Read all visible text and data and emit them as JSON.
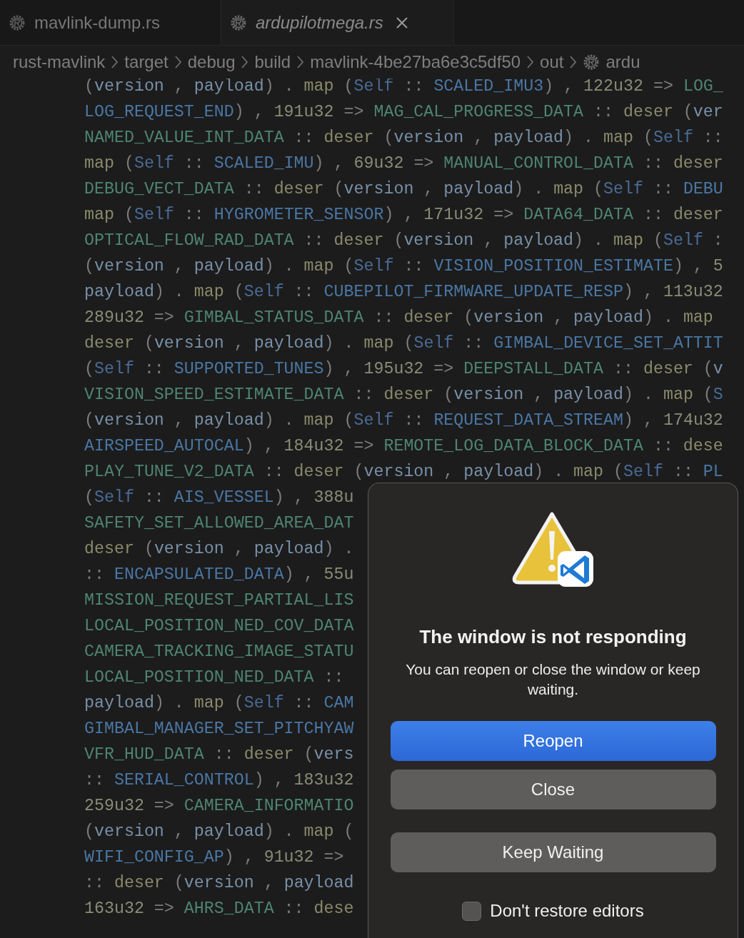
{
  "tabs": [
    {
      "label": "mavlink-dump.rs",
      "selected": false,
      "preview": false
    },
    {
      "label": "ardupilotmega.rs",
      "selected": true,
      "preview": true
    }
  ],
  "breadcrumb": [
    {
      "label": "rust-mavlink",
      "kind": "folder"
    },
    {
      "label": "target",
      "kind": "folder"
    },
    {
      "label": "debug",
      "kind": "folder"
    },
    {
      "label": "build",
      "kind": "folder"
    },
    {
      "label": "mavlink-4be27ba6e3c5df50",
      "kind": "folder"
    },
    {
      "label": "out",
      "kind": "folder"
    },
    {
      "label": "ardu",
      "kind": "file"
    }
  ],
  "code_lines": [
    [
      {
        "kind": "punct",
        "text": "("
      },
      {
        "kind": "var",
        "text": "version"
      },
      {
        "kind": "punct",
        "text": " , "
      },
      {
        "kind": "var",
        "text": "payload"
      },
      {
        "kind": "punct",
        "text": ") . "
      },
      {
        "kind": "fn",
        "text": "map"
      },
      {
        "kind": "punct",
        "text": " ("
      },
      {
        "kind": "self",
        "text": "Self"
      },
      {
        "kind": "punct",
        "text": " :: "
      },
      {
        "kind": "variant",
        "text": "SCALED_IMU3"
      },
      {
        "kind": "punct",
        "text": ") , "
      },
      {
        "kind": "num",
        "text": "122u32"
      },
      {
        "kind": "punct",
        "text": " => "
      },
      {
        "kind": "type",
        "text": "LOG_"
      }
    ],
    [
      {
        "kind": "variant",
        "text": "LOG_REQUEST_END"
      },
      {
        "kind": "punct",
        "text": ") , "
      },
      {
        "kind": "num",
        "text": "191u32"
      },
      {
        "kind": "punct",
        "text": " => "
      },
      {
        "kind": "type",
        "text": "MAG_CAL_PROGRESS_DATA"
      },
      {
        "kind": "punct",
        "text": " :: "
      },
      {
        "kind": "fn",
        "text": "deser"
      },
      {
        "kind": "punct",
        "text": " ("
      },
      {
        "kind": "var",
        "text": "ver"
      }
    ],
    [
      {
        "kind": "type",
        "text": "NAMED_VALUE_INT_DATA"
      },
      {
        "kind": "punct",
        "text": " :: "
      },
      {
        "kind": "fn",
        "text": "deser"
      },
      {
        "kind": "punct",
        "text": " ("
      },
      {
        "kind": "var",
        "text": "version"
      },
      {
        "kind": "punct",
        "text": " , "
      },
      {
        "kind": "var",
        "text": "payload"
      },
      {
        "kind": "punct",
        "text": ") . "
      },
      {
        "kind": "fn",
        "text": "map"
      },
      {
        "kind": "punct",
        "text": " ("
      },
      {
        "kind": "self",
        "text": "Self"
      },
      {
        "kind": "punct",
        "text": " ::"
      }
    ],
    [
      {
        "kind": "fn",
        "text": "map"
      },
      {
        "kind": "punct",
        "text": " ("
      },
      {
        "kind": "self",
        "text": "Self"
      },
      {
        "kind": "punct",
        "text": " :: "
      },
      {
        "kind": "variant",
        "text": "SCALED_IMU"
      },
      {
        "kind": "punct",
        "text": ") , "
      },
      {
        "kind": "num",
        "text": "69u32"
      },
      {
        "kind": "punct",
        "text": " => "
      },
      {
        "kind": "type",
        "text": "MANUAL_CONTROL_DATA"
      },
      {
        "kind": "punct",
        "text": " :: "
      },
      {
        "kind": "fn",
        "text": "deser"
      }
    ],
    [
      {
        "kind": "type",
        "text": "DEBUG_VECT_DATA"
      },
      {
        "kind": "punct",
        "text": " :: "
      },
      {
        "kind": "fn",
        "text": "deser"
      },
      {
        "kind": "punct",
        "text": " ("
      },
      {
        "kind": "var",
        "text": "version"
      },
      {
        "kind": "punct",
        "text": " , "
      },
      {
        "kind": "var",
        "text": "payload"
      },
      {
        "kind": "punct",
        "text": ") . "
      },
      {
        "kind": "fn",
        "text": "map"
      },
      {
        "kind": "punct",
        "text": " ("
      },
      {
        "kind": "self",
        "text": "Self"
      },
      {
        "kind": "punct",
        "text": " :: "
      },
      {
        "kind": "variant",
        "text": "DEBU"
      }
    ],
    [
      {
        "kind": "fn",
        "text": "map"
      },
      {
        "kind": "punct",
        "text": " ("
      },
      {
        "kind": "self",
        "text": "Self"
      },
      {
        "kind": "punct",
        "text": " :: "
      },
      {
        "kind": "variant",
        "text": "HYGROMETER_SENSOR"
      },
      {
        "kind": "punct",
        "text": ") , "
      },
      {
        "kind": "num",
        "text": "171u32"
      },
      {
        "kind": "punct",
        "text": " => "
      },
      {
        "kind": "type",
        "text": "DATA64_DATA"
      },
      {
        "kind": "punct",
        "text": " :: "
      },
      {
        "kind": "fn",
        "text": "deser"
      }
    ],
    [
      {
        "kind": "type",
        "text": "OPTICAL_FLOW_RAD_DATA"
      },
      {
        "kind": "punct",
        "text": " :: "
      },
      {
        "kind": "fn",
        "text": "deser"
      },
      {
        "kind": "punct",
        "text": " ("
      },
      {
        "kind": "var",
        "text": "version"
      },
      {
        "kind": "punct",
        "text": " , "
      },
      {
        "kind": "var",
        "text": "payload"
      },
      {
        "kind": "punct",
        "text": ") . "
      },
      {
        "kind": "fn",
        "text": "map"
      },
      {
        "kind": "punct",
        "text": " ("
      },
      {
        "kind": "self",
        "text": "Self"
      },
      {
        "kind": "punct",
        "text": " :"
      }
    ],
    [
      {
        "kind": "punct",
        "text": "("
      },
      {
        "kind": "var",
        "text": "version"
      },
      {
        "kind": "punct",
        "text": " , "
      },
      {
        "kind": "var",
        "text": "payload"
      },
      {
        "kind": "punct",
        "text": ") . "
      },
      {
        "kind": "fn",
        "text": "map"
      },
      {
        "kind": "punct",
        "text": " ("
      },
      {
        "kind": "self",
        "text": "Self"
      },
      {
        "kind": "punct",
        "text": " :: "
      },
      {
        "kind": "variant",
        "text": "VISION_POSITION_ESTIMATE"
      },
      {
        "kind": "punct",
        "text": ") , "
      },
      {
        "kind": "num",
        "text": "5"
      }
    ],
    [
      {
        "kind": "var",
        "text": "payload"
      },
      {
        "kind": "punct",
        "text": ") . "
      },
      {
        "kind": "fn",
        "text": "map"
      },
      {
        "kind": "punct",
        "text": " ("
      },
      {
        "kind": "self",
        "text": "Self"
      },
      {
        "kind": "punct",
        "text": " :: "
      },
      {
        "kind": "variant",
        "text": "CUBEPILOT_FIRMWARE_UPDATE_RESP"
      },
      {
        "kind": "punct",
        "text": ") , "
      },
      {
        "kind": "num",
        "text": "113u32"
      }
    ],
    [
      {
        "kind": "num",
        "text": "289u32"
      },
      {
        "kind": "punct",
        "text": " => "
      },
      {
        "kind": "type",
        "text": "GIMBAL_STATUS_DATA"
      },
      {
        "kind": "punct",
        "text": " :: "
      },
      {
        "kind": "fn",
        "text": "deser"
      },
      {
        "kind": "punct",
        "text": " ("
      },
      {
        "kind": "var",
        "text": "version"
      },
      {
        "kind": "punct",
        "text": " , "
      },
      {
        "kind": "var",
        "text": "payload"
      },
      {
        "kind": "punct",
        "text": ") . "
      },
      {
        "kind": "fn",
        "text": "map"
      }
    ],
    [
      {
        "kind": "fn",
        "text": "deser"
      },
      {
        "kind": "punct",
        "text": " ("
      },
      {
        "kind": "var",
        "text": "version"
      },
      {
        "kind": "punct",
        "text": " , "
      },
      {
        "kind": "var",
        "text": "payload"
      },
      {
        "kind": "punct",
        "text": ") . "
      },
      {
        "kind": "fn",
        "text": "map"
      },
      {
        "kind": "punct",
        "text": " ("
      },
      {
        "kind": "self",
        "text": "Self"
      },
      {
        "kind": "punct",
        "text": " :: "
      },
      {
        "kind": "variant",
        "text": "GIMBAL_DEVICE_SET_ATTIT"
      }
    ],
    [
      {
        "kind": "punct",
        "text": "("
      },
      {
        "kind": "self",
        "text": "Self"
      },
      {
        "kind": "punct",
        "text": " :: "
      },
      {
        "kind": "variant",
        "text": "SUPPORTED_TUNES"
      },
      {
        "kind": "punct",
        "text": ") , "
      },
      {
        "kind": "num",
        "text": "195u32"
      },
      {
        "kind": "punct",
        "text": " => "
      },
      {
        "kind": "type",
        "text": "DEEPSTALL_DATA"
      },
      {
        "kind": "punct",
        "text": " :: "
      },
      {
        "kind": "fn",
        "text": "deser"
      },
      {
        "kind": "punct",
        "text": " ("
      },
      {
        "kind": "var",
        "text": "v"
      }
    ],
    [
      {
        "kind": "type",
        "text": "VISION_SPEED_ESTIMATE_DATA"
      },
      {
        "kind": "punct",
        "text": " :: "
      },
      {
        "kind": "fn",
        "text": "deser"
      },
      {
        "kind": "punct",
        "text": " ("
      },
      {
        "kind": "var",
        "text": "version"
      },
      {
        "kind": "punct",
        "text": " , "
      },
      {
        "kind": "var",
        "text": "payload"
      },
      {
        "kind": "punct",
        "text": ") . "
      },
      {
        "kind": "fn",
        "text": "map"
      },
      {
        "kind": "punct",
        "text": " ("
      },
      {
        "kind": "self",
        "text": "S"
      }
    ],
    [
      {
        "kind": "punct",
        "text": "("
      },
      {
        "kind": "var",
        "text": "version"
      },
      {
        "kind": "punct",
        "text": " , "
      },
      {
        "kind": "var",
        "text": "payload"
      },
      {
        "kind": "punct",
        "text": ") . "
      },
      {
        "kind": "fn",
        "text": "map"
      },
      {
        "kind": "punct",
        "text": " ("
      },
      {
        "kind": "self",
        "text": "Self"
      },
      {
        "kind": "punct",
        "text": " :: "
      },
      {
        "kind": "variant",
        "text": "REQUEST_DATA_STREAM"
      },
      {
        "kind": "punct",
        "text": ") , "
      },
      {
        "kind": "num",
        "text": "174u32"
      }
    ],
    [
      {
        "kind": "variant",
        "text": "AIRSPEED_AUTOCAL"
      },
      {
        "kind": "punct",
        "text": ") , "
      },
      {
        "kind": "num",
        "text": "184u32"
      },
      {
        "kind": "punct",
        "text": " => "
      },
      {
        "kind": "type",
        "text": "REMOTE_LOG_DATA_BLOCK_DATA"
      },
      {
        "kind": "punct",
        "text": " :: "
      },
      {
        "kind": "fn",
        "text": "dese"
      }
    ],
    [
      {
        "kind": "type",
        "text": "PLAY_TUNE_V2_DATA"
      },
      {
        "kind": "punct",
        "text": " :: "
      },
      {
        "kind": "fn",
        "text": "deser"
      },
      {
        "kind": "punct",
        "text": " ("
      },
      {
        "kind": "var",
        "text": "version"
      },
      {
        "kind": "punct",
        "text": " , "
      },
      {
        "kind": "var",
        "text": "payload"
      },
      {
        "kind": "punct",
        "text": ") . "
      },
      {
        "kind": "fn",
        "text": "map"
      },
      {
        "kind": "punct",
        "text": " ("
      },
      {
        "kind": "self",
        "text": "Self"
      },
      {
        "kind": "punct",
        "text": " :: "
      },
      {
        "kind": "variant",
        "text": "PL"
      }
    ],
    [
      {
        "kind": "punct",
        "text": "("
      },
      {
        "kind": "self",
        "text": "Self"
      },
      {
        "kind": "punct",
        "text": " :: "
      },
      {
        "kind": "variant",
        "text": "AIS_VESSEL"
      },
      {
        "kind": "punct",
        "text": ") , "
      },
      {
        "kind": "num",
        "text": "388u"
      }
    ],
    [
      {
        "kind": "type",
        "text": "SAFETY_SET_ALLOWED_AREA_DAT"
      }
    ],
    [
      {
        "kind": "fn",
        "text": "deser"
      },
      {
        "kind": "punct",
        "text": " ("
      },
      {
        "kind": "var",
        "text": "version"
      },
      {
        "kind": "punct",
        "text": " , "
      },
      {
        "kind": "var",
        "text": "payload"
      },
      {
        "kind": "punct",
        "text": ") ."
      }
    ],
    [
      {
        "kind": "punct",
        "text": ":: "
      },
      {
        "kind": "variant",
        "text": "ENCAPSULATED_DATA"
      },
      {
        "kind": "punct",
        "text": ") , "
      },
      {
        "kind": "num",
        "text": "55u"
      }
    ],
    [
      {
        "kind": "type",
        "text": "MISSION_REQUEST_PARTIAL_LIS"
      }
    ],
    [
      {
        "kind": "type",
        "text": "LOCAL_POSITION_NED_COV_DATA"
      }
    ],
    [
      {
        "kind": "type",
        "text": "CAMERA_TRACKING_IMAGE_STATU"
      }
    ],
    [
      {
        "kind": "type",
        "text": "LOCAL_POSITION_NED_DATA"
      },
      {
        "kind": "punct",
        "text": " ::"
      }
    ],
    [
      {
        "kind": "var",
        "text": "payload"
      },
      {
        "kind": "punct",
        "text": ") . "
      },
      {
        "kind": "fn",
        "text": "map"
      },
      {
        "kind": "punct",
        "text": " ("
      },
      {
        "kind": "self",
        "text": "Self"
      },
      {
        "kind": "punct",
        "text": " :: "
      },
      {
        "kind": "variant",
        "text": "CAM"
      }
    ],
    [
      {
        "kind": "variant",
        "text": "GIMBAL_MANAGER_SET_PITCHYAW"
      }
    ],
    [
      {
        "kind": "type",
        "text": "VFR_HUD_DATA"
      },
      {
        "kind": "punct",
        "text": " :: "
      },
      {
        "kind": "fn",
        "text": "deser"
      },
      {
        "kind": "punct",
        "text": " ("
      },
      {
        "kind": "var",
        "text": "vers"
      }
    ],
    [
      {
        "kind": "punct",
        "text": ":: "
      },
      {
        "kind": "variant",
        "text": "SERIAL_CONTROL"
      },
      {
        "kind": "punct",
        "text": ") , "
      },
      {
        "kind": "num",
        "text": "183u32"
      }
    ],
    [
      {
        "kind": "num",
        "text": "259u32"
      },
      {
        "kind": "punct",
        "text": " => "
      },
      {
        "kind": "type",
        "text": "CAMERA_INFORMATIO"
      }
    ],
    [
      {
        "kind": "punct",
        "text": "("
      },
      {
        "kind": "var",
        "text": "version"
      },
      {
        "kind": "punct",
        "text": " , "
      },
      {
        "kind": "var",
        "text": "payload"
      },
      {
        "kind": "punct",
        "text": ") . "
      },
      {
        "kind": "fn",
        "text": "map"
      },
      {
        "kind": "punct",
        "text": " ("
      }
    ],
    [
      {
        "kind": "variant",
        "text": "WIFI_CONFIG_AP"
      },
      {
        "kind": "punct",
        "text": ") , "
      },
      {
        "kind": "num",
        "text": "91u32"
      },
      {
        "kind": "punct",
        "text": " =>"
      }
    ],
    [
      {
        "kind": "punct",
        "text": ":: "
      },
      {
        "kind": "fn",
        "text": "deser"
      },
      {
        "kind": "punct",
        "text": " ("
      },
      {
        "kind": "var",
        "text": "version"
      },
      {
        "kind": "punct",
        "text": " , "
      },
      {
        "kind": "var",
        "text": "payload"
      }
    ],
    [
      {
        "kind": "num",
        "text": "163u32"
      },
      {
        "kind": "punct",
        "text": " => "
      },
      {
        "kind": "type",
        "text": "AHRS_DATA"
      },
      {
        "kind": "punct",
        "text": " :: "
      },
      {
        "kind": "fn",
        "text": "dese"
      }
    ]
  ],
  "dialog": {
    "title": "The window is not responding",
    "message": "You can reopen or close the window or keep waiting.",
    "buttons": [
      {
        "label": "Reopen",
        "kind": "primary"
      },
      {
        "label": "Close",
        "kind": "secondary"
      },
      {
        "label": "Keep Waiting",
        "kind": "secondary"
      }
    ],
    "checkbox": {
      "label": "Don't restore editors",
      "checked": false
    }
  }
}
